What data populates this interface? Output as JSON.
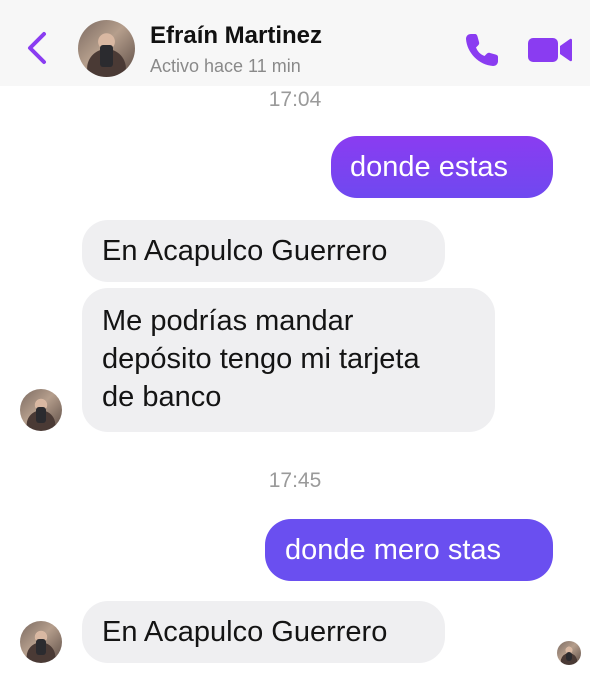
{
  "header": {
    "contact_name": "Efraín Martinez",
    "status": "Activo hace 11 min",
    "icons": {
      "back": "chevron-left-icon",
      "call": "phone-icon",
      "video": "video-camera-icon"
    },
    "accent_color": "#8a3cf1"
  },
  "messages": [
    {
      "type": "timestamp",
      "text": "17:04"
    },
    {
      "type": "outgoing",
      "text": "donde estas"
    },
    {
      "type": "incoming",
      "text": "En Acapulco Guerrero"
    },
    {
      "type": "incoming",
      "lines": [
        "Me podrías mandar",
        "depósito tengo mi tarjeta",
        "de banco"
      ]
    },
    {
      "type": "timestamp",
      "text": "17:45"
    },
    {
      "type": "outgoing",
      "text": "donde mero stas"
    },
    {
      "type": "incoming",
      "text": "En Acapulco Guerrero"
    }
  ],
  "colors": {
    "outgoing_bubble": "#7a3ff2",
    "incoming_bubble": "#efeff1",
    "timestamp_text": "#9a9a9a"
  }
}
